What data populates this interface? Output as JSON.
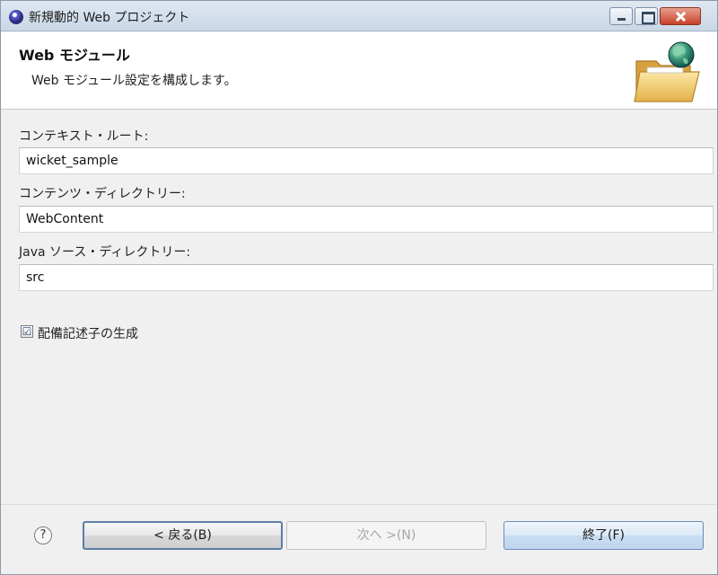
{
  "window": {
    "title": "新規動的 Web プロジェクト",
    "accent_color": "#c8412a",
    "controls": {
      "minimize_icon": "minimize-icon",
      "maximize_icon": "maximize-icon",
      "close_icon": "close-icon"
    }
  },
  "banner": {
    "title": "Web モジュール",
    "description": "Web モジュール設定を構成します。",
    "icon": "folder-globe-icon"
  },
  "form": {
    "context_root": {
      "label": "コンテキスト・ルート:",
      "value": "wicket_sample"
    },
    "content_dir": {
      "label": "コンテンツ・ディレクトリー:",
      "value": "WebContent"
    },
    "java_source_dir": {
      "label": "Java ソース・ディレクトリー:",
      "value": "src"
    },
    "generate_descriptor": {
      "label": "配備記述子の生成",
      "checked": true,
      "mark": "☑"
    }
  },
  "buttons": {
    "help_icon": "?",
    "back": "< 戻る(B)",
    "next": "次へ >(N)",
    "finish": "終了(F)"
  }
}
